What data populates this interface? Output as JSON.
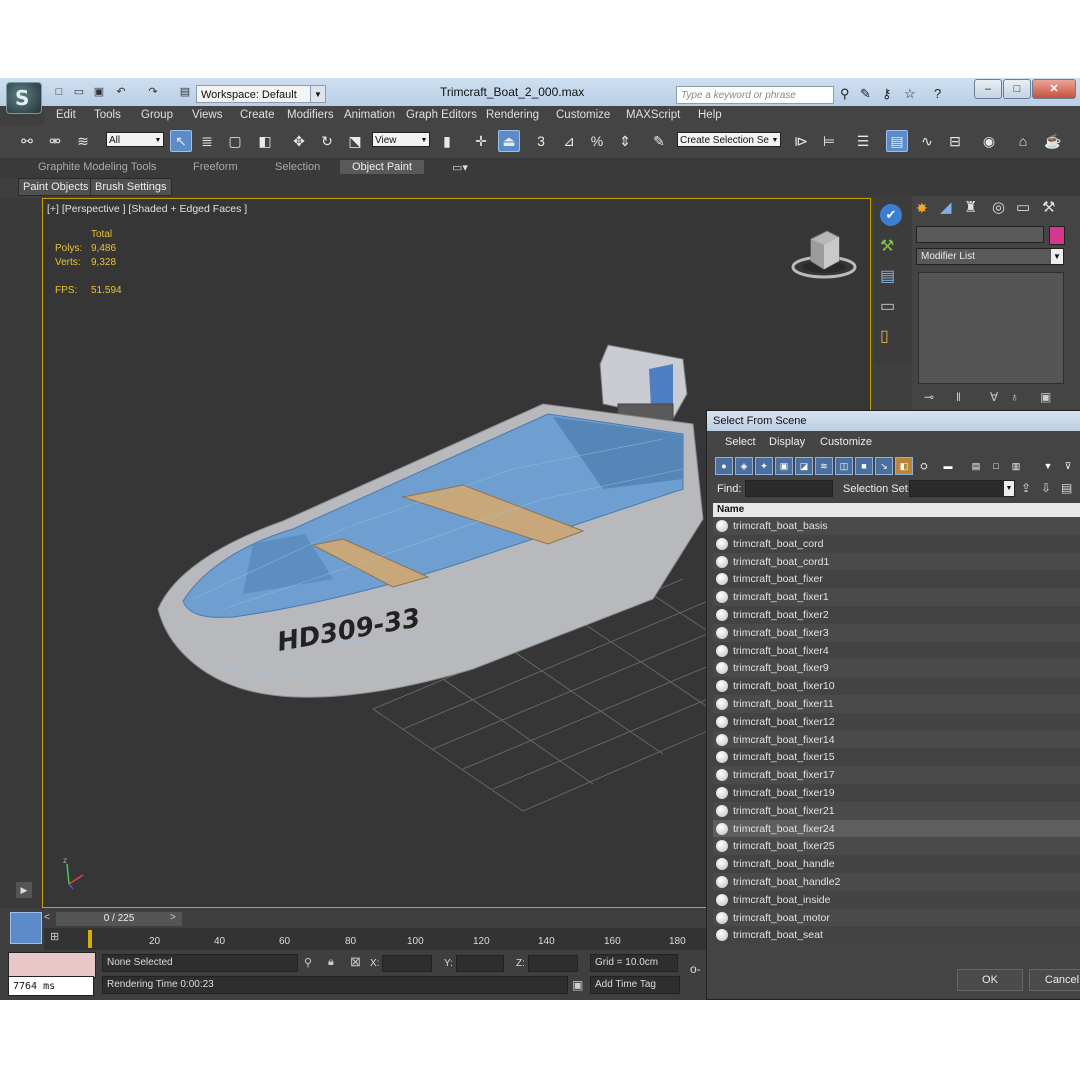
{
  "app": {
    "workspace": "Workspace: Default",
    "document_title": "Trimcraft_Boat_2_000.max",
    "search_placeholder": "Type a keyword or phrase"
  },
  "menu": [
    "Edit",
    "Tools",
    "Group",
    "Views",
    "Create",
    "Modifiers",
    "Animation",
    "Graph Editors",
    "Rendering",
    "Customize",
    "MAXScript",
    "Help"
  ],
  "toolbar": {
    "selection_filter": "All",
    "reference_coord": "View",
    "selection_set": "Create Selection Se",
    "snap_labels": [
      "3",
      "%"
    ]
  },
  "ribbon": {
    "tabs": [
      "Graphite Modeling Tools",
      "Freeform",
      "Selection",
      "Object Paint"
    ],
    "active_tab": "Object Paint",
    "sub_tabs": [
      "Paint Objects",
      "Brush Settings"
    ]
  },
  "viewport": {
    "label": "[+] [Perspective ] [Shaded + Edged Faces ]",
    "stats_header": "Total",
    "polys_label": "Polys:",
    "polys_value": "9,486",
    "verts_label": "Verts:",
    "verts_value": "9,328",
    "fps_label": "FPS:",
    "fps_value": "51.594",
    "hull_text": "HD309-33"
  },
  "command_panel": {
    "modifier_list": "Modifier List",
    "color_swatch": "#d4388e"
  },
  "timeline": {
    "frame_display": "0 / 225",
    "ticks": [
      "20",
      "40",
      "60",
      "80",
      "100",
      "120",
      "140",
      "160",
      "180"
    ]
  },
  "status": {
    "render_ms": "7764 ms",
    "selection": "None Selected",
    "rendering_time": "Rendering Time  0:00:23",
    "x_label": "X:",
    "y_label": "Y:",
    "z_label": "Z:",
    "grid": "Grid = 10.0cm",
    "add_time_tag": "Add Time Tag"
  },
  "dialog": {
    "title": "Select From Scene",
    "menu": [
      "Select",
      "Display",
      "Customize"
    ],
    "find_label": "Find:",
    "selection_set_label": "Selection Set:",
    "column_name": "Name",
    "items": [
      "trimcraft_boat_basis",
      "trimcraft_boat_cord",
      "trimcraft_boat_cord1",
      "trimcraft_boat_fixer",
      "trimcraft_boat_fixer1",
      "trimcraft_boat_fixer2",
      "trimcraft_boat_fixer3",
      "trimcraft_boat_fixer4",
      "trimcraft_boat_fixer9",
      "trimcraft_boat_fixer10",
      "trimcraft_boat_fixer11",
      "trimcraft_boat_fixer12",
      "trimcraft_boat_fixer14",
      "trimcraft_boat_fixer15",
      "trimcraft_boat_fixer17",
      "trimcraft_boat_fixer19",
      "trimcraft_boat_fixer21",
      "trimcraft_boat_fixer24",
      "trimcraft_boat_fixer25",
      "trimcraft_boat_handle",
      "trimcraft_boat_handle2",
      "trimcraft_boat_inside",
      "trimcraft_boat_motor",
      "trimcraft_boat_seat"
    ],
    "highlighted_item": "trimcraft_boat_fixer24",
    "ok": "OK",
    "cancel": "Cancel"
  }
}
